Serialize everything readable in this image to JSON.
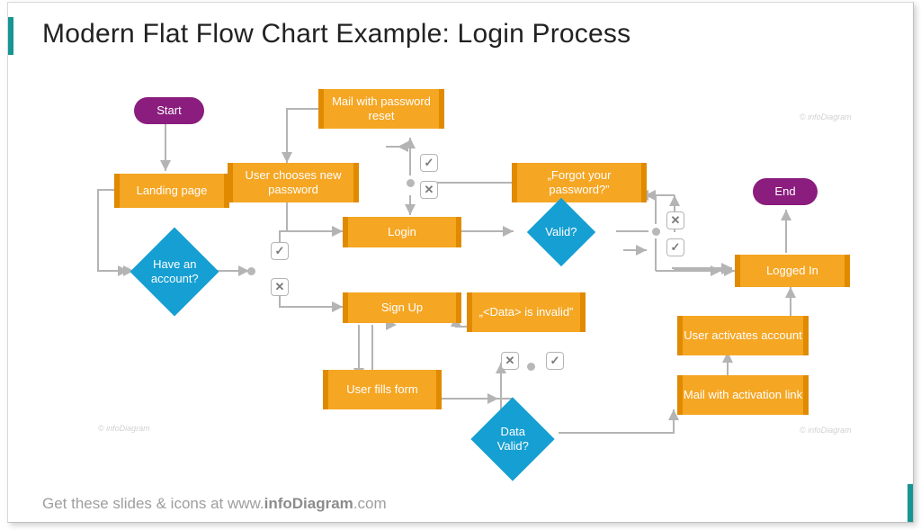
{
  "title": "Modern Flat Flow Chart Example: Login Process",
  "terminals": {
    "start": "Start",
    "end": "End"
  },
  "processes": {
    "landing": "Landing page",
    "mail_reset": "Mail with password reset",
    "new_pw": "User chooses new password",
    "forgot": "„Forgot your password?”",
    "login": "Login",
    "signup": "Sign Up",
    "data_invalid": "„<Data> is invalid”",
    "fills_form": "User fills form",
    "logged_in": "Logged In",
    "activate": "User activates account",
    "mail_activate": "Mail with activation link"
  },
  "decisions": {
    "have_account": "Have an account?",
    "valid": "Valid?",
    "data_valid": "Data Valid?"
  },
  "footer_prefix": "Get these slides & icons at ",
  "footer_domain_pre": "www.",
  "footer_domain_bold": "infoDiagram",
  "footer_domain_suf": ".com",
  "watermark": "© infoDiagram",
  "colors": {
    "accent": "#179494",
    "process": "#f5a623",
    "process_edge": "#e08a00",
    "terminal": "#8a1d7d",
    "decision": "#159fd2",
    "wire": "#b4b4b4"
  },
  "chart_data": {
    "type": "flowchart",
    "title": "Login Process",
    "nodes": [
      {
        "id": "start",
        "kind": "terminal",
        "label": "Start"
      },
      {
        "id": "landing",
        "kind": "process",
        "label": "Landing page"
      },
      {
        "id": "have_account",
        "kind": "decision",
        "label": "Have an account?"
      },
      {
        "id": "login",
        "kind": "process",
        "label": "Login"
      },
      {
        "id": "signup",
        "kind": "process",
        "label": "Sign Up"
      },
      {
        "id": "valid",
        "kind": "decision",
        "label": "Valid?"
      },
      {
        "id": "forgot",
        "kind": "process",
        "label": "„Forgot your password?”"
      },
      {
        "id": "mail_reset",
        "kind": "process",
        "label": "Mail with password reset"
      },
      {
        "id": "new_pw",
        "kind": "process",
        "label": "User chooses new password"
      },
      {
        "id": "fills_form",
        "kind": "process",
        "label": "User fills form"
      },
      {
        "id": "data_valid",
        "kind": "decision",
        "label": "Data Valid?"
      },
      {
        "id": "data_invalid",
        "kind": "process",
        "label": "„<Data> is invalid”"
      },
      {
        "id": "mail_activate",
        "kind": "process",
        "label": "Mail with activation link"
      },
      {
        "id": "activate",
        "kind": "process",
        "label": "User activates account"
      },
      {
        "id": "logged_in",
        "kind": "process",
        "label": "Logged In"
      },
      {
        "id": "end",
        "kind": "terminal",
        "label": "End"
      }
    ],
    "edges": [
      {
        "from": "start",
        "to": "landing"
      },
      {
        "from": "landing",
        "to": "have_account"
      },
      {
        "from": "have_account",
        "to": "login",
        "label": "yes"
      },
      {
        "from": "have_account",
        "to": "signup",
        "label": "no"
      },
      {
        "from": "login",
        "to": "valid"
      },
      {
        "from": "valid",
        "to": "logged_in",
        "label": "yes"
      },
      {
        "from": "valid",
        "to": "forgot",
        "label": "no"
      },
      {
        "from": "forgot",
        "to": "mail_reset",
        "label": "yes"
      },
      {
        "from": "forgot",
        "to": "login",
        "label": "no"
      },
      {
        "from": "mail_reset",
        "to": "new_pw"
      },
      {
        "from": "new_pw",
        "to": "login"
      },
      {
        "from": "signup",
        "to": "fills_form"
      },
      {
        "from": "fills_form",
        "to": "data_valid"
      },
      {
        "from": "data_valid",
        "to": "mail_activate",
        "label": "yes"
      },
      {
        "from": "data_valid",
        "to": "data_invalid",
        "label": "no"
      },
      {
        "from": "data_invalid",
        "to": "signup"
      },
      {
        "from": "mail_activate",
        "to": "activate"
      },
      {
        "from": "activate",
        "to": "logged_in"
      },
      {
        "from": "logged_in",
        "to": "end"
      }
    ]
  }
}
